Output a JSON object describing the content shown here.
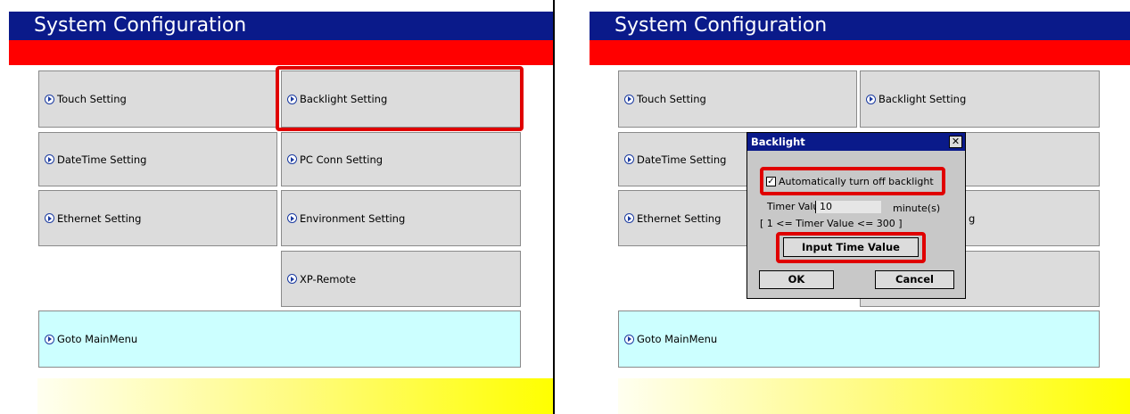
{
  "colors": {
    "header_bg": "#0a1a8a",
    "red_bar": "#ff0000",
    "button_bg": "#dcdcdc",
    "main_menu_bg": "#ccffff",
    "highlight": "#e00000"
  },
  "left": {
    "title": "System Configuration",
    "buttons": {
      "touch": "Touch Setting",
      "backlight": "Backlight Setting",
      "datetime": "DateTime Setting",
      "pcconn": "PC Conn Setting",
      "ethernet": "Ethernet Setting",
      "environment": "Environment Setting",
      "xpremote": "XP-Remote",
      "main": "Goto MainMenu"
    }
  },
  "right": {
    "title": "System Configuration",
    "buttons": {
      "touch": "Touch Setting",
      "backlight": "Backlight Setting",
      "datetime": "DateTime Setting",
      "ethernet": "Ethernet Setting",
      "main": "Goto MainMenu"
    },
    "dialog": {
      "title": "Backlight",
      "close": "✕",
      "checkbox_label": "Automatically turn off backlight",
      "checkbox_checked": "✓",
      "timer_label": "Timer Value :",
      "timer_value": "10",
      "timer_unit": "minute(s)",
      "range": "[ 1 <= Timer Value <= 300 ]",
      "input_button": "Input Time Value",
      "ok": "OK",
      "cancel": "Cancel",
      "partial_right_text": "g"
    }
  }
}
